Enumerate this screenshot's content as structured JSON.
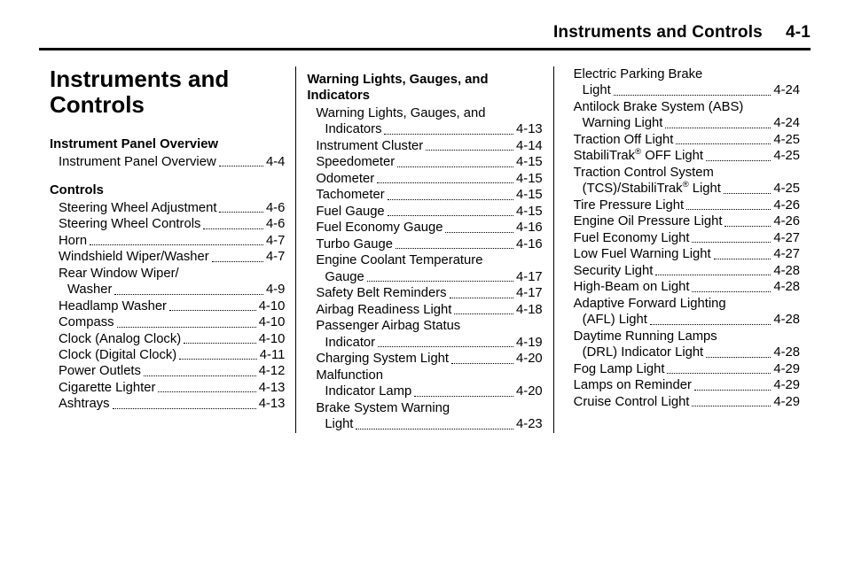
{
  "header": {
    "chapter": "Instruments and Controls",
    "page": "4-1"
  },
  "chapter_title": "Instruments and Controls",
  "col1": [
    {
      "type": "section",
      "text": "Instrument Panel Overview"
    },
    {
      "type": "entry",
      "label": "Instrument Panel Overview",
      "page": "4-4"
    },
    {
      "type": "gap"
    },
    {
      "type": "section",
      "text": "Controls"
    },
    {
      "type": "entry",
      "label": "Steering Wheel Adjustment",
      "page": "4-6"
    },
    {
      "type": "entry",
      "label": "Steering Wheel Controls",
      "page": "4-6"
    },
    {
      "type": "entry",
      "label": "Horn",
      "page": "4-7"
    },
    {
      "type": "entry",
      "label": "Windshield Wiper/Washer",
      "page": "4-7"
    },
    {
      "type": "entry-multi",
      "lines": [
        "Rear Window Wiper/"
      ],
      "lastLabel": "Washer",
      "page": "4-9"
    },
    {
      "type": "entry",
      "label": "Headlamp Washer",
      "page": "4-10"
    },
    {
      "type": "entry",
      "label": "Compass",
      "page": "4-10"
    },
    {
      "type": "entry",
      "label": "Clock (Analog Clock)",
      "page": "4-10"
    },
    {
      "type": "entry",
      "label": "Clock (Digital Clock)",
      "page": "4-11"
    },
    {
      "type": "entry",
      "label": "Power Outlets",
      "page": "4-12"
    },
    {
      "type": "entry",
      "label": "Cigarette Lighter",
      "page": "4-13"
    },
    {
      "type": "entry",
      "label": "Ashtrays",
      "page": "4-13"
    }
  ],
  "col2": [
    {
      "type": "section",
      "text": "Warning Lights, Gauges, and Indicators"
    },
    {
      "type": "entry-multi",
      "lines": [
        "Warning Lights, Gauges, and"
      ],
      "lastLabel": "Indicators",
      "page": "4-13"
    },
    {
      "type": "entry",
      "label": "Instrument Cluster",
      "page": "4-14"
    },
    {
      "type": "entry",
      "label": "Speedometer",
      "page": "4-15"
    },
    {
      "type": "entry",
      "label": "Odometer",
      "page": "4-15"
    },
    {
      "type": "entry",
      "label": "Tachometer",
      "page": "4-15"
    },
    {
      "type": "entry",
      "label": "Fuel Gauge",
      "page": "4-15"
    },
    {
      "type": "entry",
      "label": "Fuel Economy Gauge",
      "page": "4-16"
    },
    {
      "type": "entry",
      "label": "Turbo Gauge",
      "page": "4-16"
    },
    {
      "type": "entry-multi",
      "lines": [
        "Engine Coolant Temperature"
      ],
      "lastLabel": "Gauge",
      "page": "4-17"
    },
    {
      "type": "entry",
      "label": "Safety Belt Reminders",
      "page": "4-17"
    },
    {
      "type": "entry",
      "label": "Airbag Readiness Light",
      "page": "4-18"
    },
    {
      "type": "entry-multi",
      "lines": [
        "Passenger Airbag Status"
      ],
      "lastLabel": "Indicator",
      "page": "4-19"
    },
    {
      "type": "entry",
      "label": "Charging System Light",
      "page": "4-20"
    },
    {
      "type": "entry-multi",
      "lines": [
        "Malfunction"
      ],
      "lastLabel": "Indicator Lamp",
      "page": "4-20"
    },
    {
      "type": "entry-multi",
      "lines": [
        "Brake System Warning"
      ],
      "lastLabel": "Light",
      "page": "4-23"
    }
  ],
  "col3": [
    {
      "type": "entry-multi",
      "lines": [
        "Electric Parking Brake"
      ],
      "lastLabel": "Light",
      "page": "4-24"
    },
    {
      "type": "entry-multi",
      "lines": [
        "Antilock Brake System (ABS)"
      ],
      "lastLabel": "Warning Light",
      "page": "4-24"
    },
    {
      "type": "entry",
      "label": "Traction Off Light",
      "page": "4-25"
    },
    {
      "type": "entry-html",
      "label": "StabiliTrak<sup>®</sup> OFF Light",
      "page": "4-25"
    },
    {
      "type": "entry-multi-html",
      "lines": [
        "Traction Control System"
      ],
      "lastLabel": "(TCS)/StabiliTrak<sup>®</sup> Light",
      "page": "4-25"
    },
    {
      "type": "entry",
      "label": "Tire Pressure Light",
      "page": "4-26"
    },
    {
      "type": "entry",
      "label": "Engine Oil Pressure Light",
      "page": "4-26"
    },
    {
      "type": "entry",
      "label": "Fuel Economy Light",
      "page": "4-27"
    },
    {
      "type": "entry",
      "label": "Low Fuel Warning Light",
      "page": "4-27"
    },
    {
      "type": "entry",
      "label": "Security Light",
      "page": "4-28"
    },
    {
      "type": "entry",
      "label": "High-Beam on Light",
      "page": "4-28"
    },
    {
      "type": "entry-multi",
      "lines": [
        "Adaptive Forward Lighting"
      ],
      "lastLabel": "(AFL) Light",
      "page": "4-28"
    },
    {
      "type": "entry-multi",
      "lines": [
        "Daytime Running Lamps"
      ],
      "lastLabel": "(DRL) Indicator Light",
      "page": "4-28"
    },
    {
      "type": "entry",
      "label": "Fog Lamp Light",
      "page": "4-29"
    },
    {
      "type": "entry",
      "label": "Lamps on Reminder",
      "page": "4-29"
    },
    {
      "type": "entry",
      "label": "Cruise Control Light",
      "page": "4-29"
    }
  ]
}
